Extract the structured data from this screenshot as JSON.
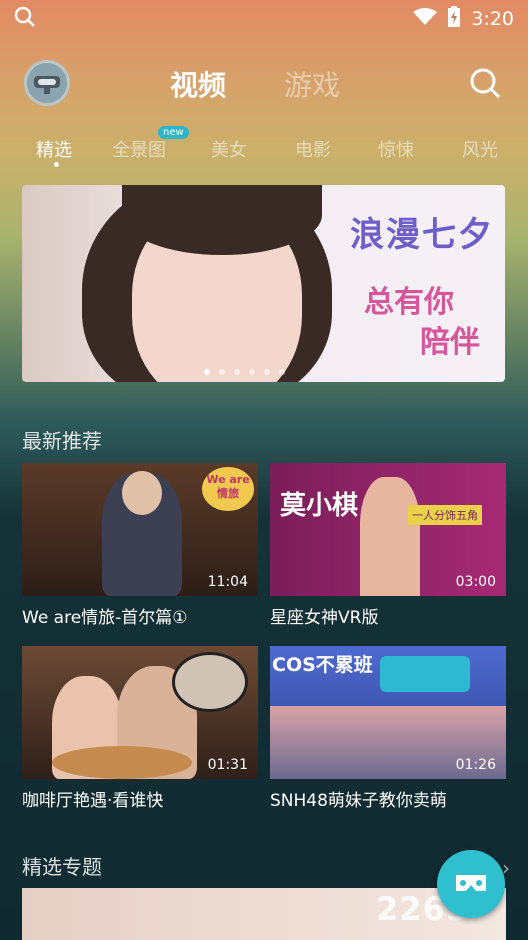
{
  "status_bar": {
    "time": "3:20"
  },
  "header": {
    "tabs": [
      {
        "label": "视频",
        "active": true
      },
      {
        "label": "游戏",
        "active": false
      }
    ]
  },
  "categories": {
    "items": [
      "精选",
      "全景图",
      "美女",
      "电影",
      "惊悚",
      "风光"
    ],
    "active_index": 0,
    "new_badge": "new"
  },
  "banner": {
    "title": "浪漫七夕",
    "subtitle_line1": "总有你",
    "subtitle_line2": "陪伴",
    "page_count": 6,
    "current_page": 1
  },
  "recommend": {
    "section_title": "最新推荐",
    "videos": [
      {
        "title": "We are情旅-首尔篇①",
        "duration": "11:04",
        "thumb_text": "We are\n情旅"
      },
      {
        "title": "星座女神VR版",
        "duration": "03:00",
        "thumb_text": "莫小棋",
        "thumb_sub": "一人分饰五角"
      },
      {
        "title": "咖啡厅艳遇·看谁快",
        "duration": "01:31"
      },
      {
        "title": "SNH48萌妹子教你卖萌",
        "duration": "01:26",
        "thumb_text": "COS不累班"
      }
    ]
  },
  "featured": {
    "section_title": "精选专题"
  },
  "watermark": "2265",
  "colors": {
    "accent": "#2fbfcf",
    "badge": "#2bb7c9",
    "banner_title": "#6e5ec9",
    "banner_sub": "#d6569a"
  },
  "icons": {
    "search": "search-icon",
    "wifi": "wifi-icon",
    "battery": "battery-charging-icon",
    "vr": "vr-headset-icon"
  }
}
